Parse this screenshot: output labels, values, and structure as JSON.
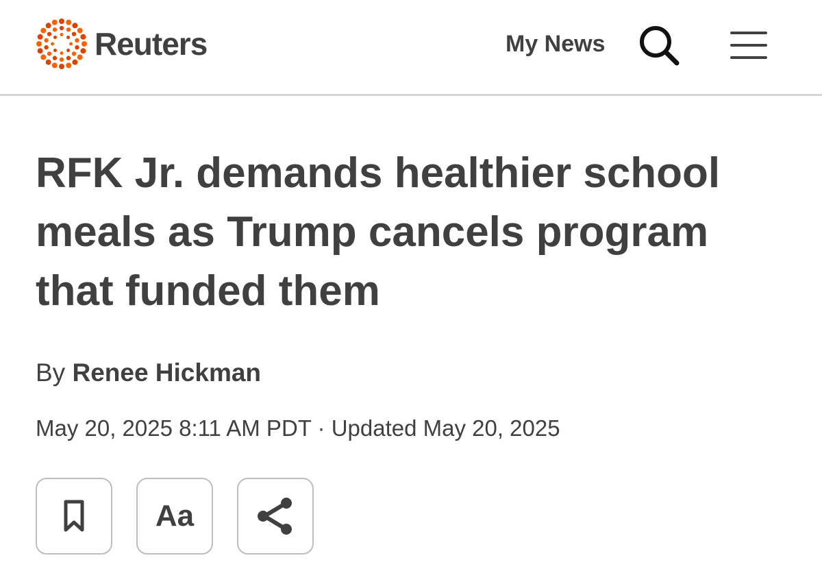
{
  "header": {
    "brand_name": "Reuters",
    "my_news_label": "My News",
    "search_icon": "search-icon",
    "menu_icon": "hamburger-menu-icon",
    "logo_colors": [
      "#fa6400",
      "#dc4300"
    ]
  },
  "article": {
    "headline": "RFK Jr. demands healthier school meals as Trump cancels program that funded them",
    "byline_prefix": "By",
    "author": "Renee Hickman",
    "published": "May 20, 2025 8:11 AM PDT",
    "separator": "·",
    "updated": "Updated May 20, 2025"
  },
  "tools": {
    "bookmark_icon": "bookmark-icon",
    "text_size_label": "Aa",
    "share_icon": "share-icon"
  },
  "colors": {
    "text": "#404040",
    "brand_orange": "#fa6400",
    "divider": "#d6d6d6",
    "button_border": "#bdbdbd"
  }
}
